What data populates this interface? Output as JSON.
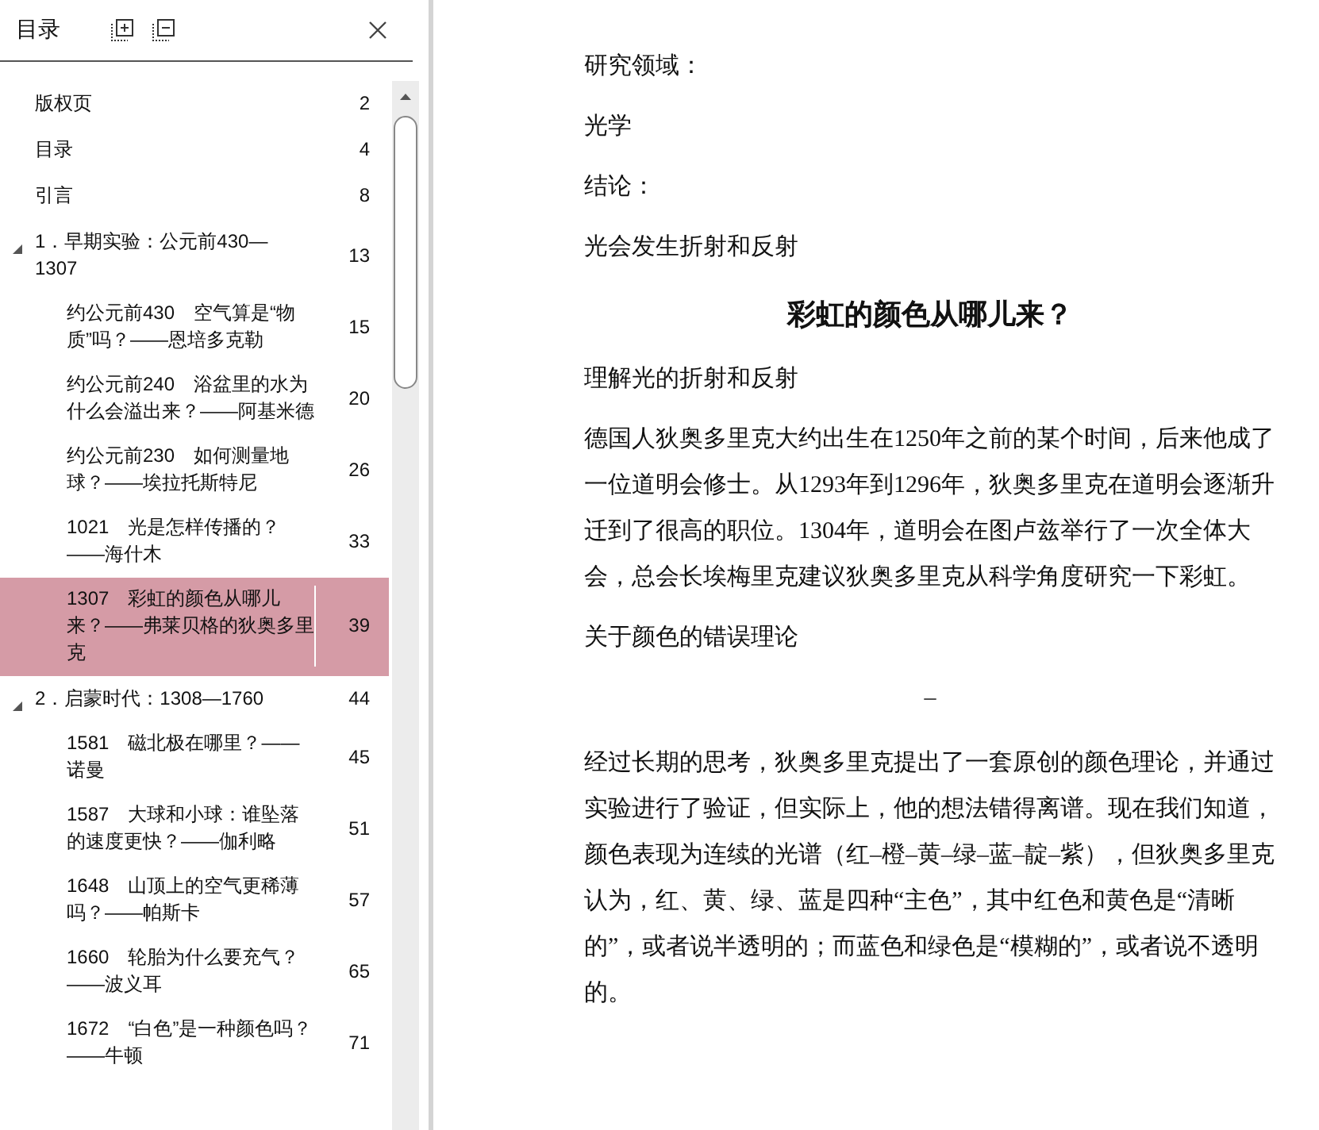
{
  "toc": {
    "title": "目录",
    "items": [
      {
        "label": "版权页",
        "page": "2",
        "selected": false
      },
      {
        "label": "目录",
        "page": "4",
        "selected": false
      },
      {
        "label": "引言",
        "page": "8",
        "selected": false
      },
      {
        "label": "1．早期实验：公元前430—1307",
        "page": "13",
        "selected": false,
        "expanded": true,
        "children": [
          {
            "label": "约公元前430　空气算是“物质”吗？——恩培多克勒",
            "page": "15",
            "selected": false
          },
          {
            "label": "约公元前240　浴盆里的水为什么会溢出来？——阿基米德",
            "page": "20",
            "selected": false
          },
          {
            "label": "约公元前230　如何测量地球？——埃拉托斯特尼",
            "page": "26",
            "selected": false
          },
          {
            "label": "1021　光是怎样传播的？——海什木",
            "page": "33",
            "selected": false
          },
          {
            "label": "1307　彩虹的颜色从哪儿来？——弗莱贝格的狄奥多里克",
            "page": "39",
            "selected": true
          }
        ]
      },
      {
        "label": "2．启蒙时代：1308—1760",
        "page": "44",
        "selected": false,
        "expanded": true,
        "children": [
          {
            "label": "1581　磁北极在哪里？——诺曼",
            "page": "45",
            "selected": false
          },
          {
            "label": "1587　大球和小球：谁坠落的速度更快？——伽利略",
            "page": "51",
            "selected": false
          },
          {
            "label": "1648　山顶上的空气更稀薄吗？——帕斯卡",
            "page": "57",
            "selected": false
          },
          {
            "label": "1660　轮胎为什么要充气？——波义耳",
            "page": "65",
            "selected": false
          },
          {
            "label": "1672　“白色”是一种颜色吗？——牛顿",
            "page": "71",
            "selected": false
          }
        ]
      }
    ]
  },
  "content": [
    {
      "kind": "para",
      "text": "研究领域："
    },
    {
      "kind": "para",
      "text": "光学"
    },
    {
      "kind": "para",
      "text": "结论："
    },
    {
      "kind": "para",
      "text": "光会发生折射和反射"
    },
    {
      "kind": "heading",
      "text": "彩虹的颜色从哪儿来？"
    },
    {
      "kind": "para",
      "text": "理解光的折射和反射"
    },
    {
      "kind": "para",
      "text": "德国人狄奥多里克大约出生在1250年之前的某个时间，后来他成了一位道明会修士。从1293年到1296年，狄奥多里克在道明会逐渐升迁到了很高的职位。1304年，道明会在图卢兹举行了一次全体大会，总会长埃梅里克建议狄奥多里克从科学角度研究一下彩虹。"
    },
    {
      "kind": "para",
      "text": "关于颜色的错误理论"
    },
    {
      "kind": "separator",
      "text": "–"
    },
    {
      "kind": "para",
      "text": "经过长期的思考，狄奥多里克提出了一套原创的颜色理论，并通过实验进行了验证，但实际上，他的想法错得离谱。现在我们知道，颜色表现为连续的光谱（红–橙–黄–绿–蓝–靛–紫），但狄奥多里克认为，红、黄、绿、蓝是四种“主色”，其中红色和黄色是“清晰的”，或者说半透明的；而蓝色和绿色是“模糊的”，或者说不透明的。"
    }
  ]
}
